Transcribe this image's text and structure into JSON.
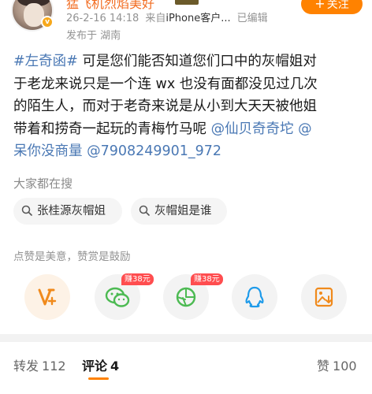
{
  "user": {
    "name": "猛飞机烈焰美好",
    "timestamp": "26-2-16 14:18",
    "source_prefix": "来自",
    "source": "iPhone客户...",
    "edited": "已编辑",
    "location": "发布于 湖南",
    "follow_label": "关注",
    "verified_badge": "v"
  },
  "post": {
    "hashtag": "#左奇函#",
    "lines": [
      "可是您们能否知道您们口中的灰帽姐对",
      "于老龙来说只是一个连 wx 也没有面都没见过几次",
      "的陌生人，而对于老奇来说是从小到大天天被他姐",
      "带着和捞奇一起玩的青梅竹马呢 ",
      "呆你没商量 "
    ],
    "mentions": [
      "@仙贝奇奇坨 @",
      "@7908249901_972"
    ]
  },
  "search": {
    "title": "大家都在搜",
    "chips": [
      "张桂源灰帽姐",
      "灰帽姐是谁"
    ]
  },
  "praise": {
    "text": "点赞是美意，赞赏是鼓励",
    "bonus_labels": [
      "赚38元",
      "赚38元"
    ],
    "icons": [
      "praise-v-icon",
      "wechat-icon",
      "moments-icon",
      "qq-icon",
      "save-image-icon"
    ]
  },
  "tabs": {
    "repost_label": "转发",
    "repost_count": "112",
    "comment_label": "评论",
    "comment_count": "4",
    "like_label": "赞",
    "like_count": "100"
  },
  "colors": {
    "accent": "#ff8200",
    "link": "#4a78b4",
    "bonus": "#ff4d4f"
  }
}
